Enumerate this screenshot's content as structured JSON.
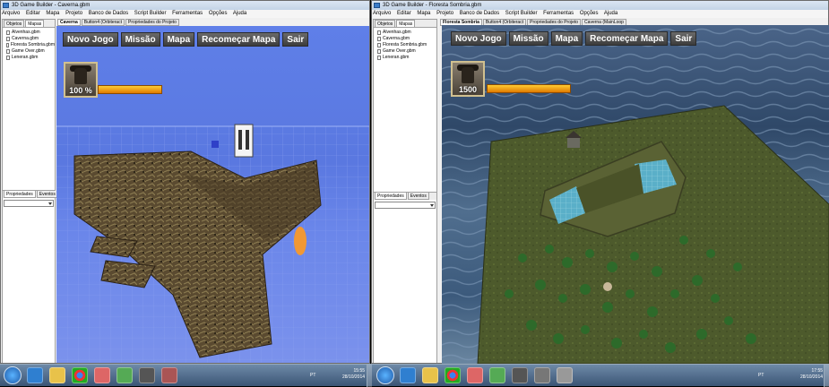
{
  "left_window": {
    "title": "3D Game Builder - Caverna.gbm",
    "menu": [
      "Arquivo",
      "Editar",
      "Mapa",
      "Projeto",
      "Banco de Dados",
      "Script Builder",
      "Ferramentas",
      "Opções",
      "Ajuda"
    ],
    "panel_tabs": [
      "Objetos",
      "Mapas"
    ],
    "tree_items": [
      "Alvenhas.gbm",
      "Caverna.gbm",
      "Floresta Sombria.gbm",
      "Game Over.gbm",
      "Leneran.gbm"
    ],
    "prop_tabs": [
      "Propriedades",
      "Eventos"
    ],
    "doc_tabs": [
      "Caverna",
      "Button4 (Orbiteract",
      "Propriedades do Projeto"
    ],
    "hud_buttons": [
      "Novo Jogo",
      "Missão",
      "Mapa",
      "Recomeçar Mapa",
      "Sair"
    ],
    "portrait_value": "100 %",
    "health_fraction": 1.0
  },
  "right_window": {
    "title": "3D Game Builder - Floresta Sombria.gbm",
    "menu": [
      "Arquivo",
      "Editar",
      "Mapa",
      "Projeto",
      "Banco de Dados",
      "Script Builder",
      "Ferramentas",
      "Opções",
      "Ajuda"
    ],
    "panel_tabs": [
      "Objetos",
      "Mapas"
    ],
    "tree_items": [
      "Alvenhas.gbm",
      "Caverna.gbm",
      "Floresta Sombria.gbm",
      "Game Over.gbm",
      "Leneran.gbm"
    ],
    "prop_tabs": [
      "Propriedades",
      "Eventos"
    ],
    "doc_tabs": [
      "Floresta Sombria",
      "Button4 (Orbiteract",
      "Propriedades do Projeto",
      "Caverna (MainLoop"
    ],
    "hud_buttons": [
      "Novo Jogo",
      "Missão",
      "Mapa",
      "Recomeçar Mapa",
      "Sair"
    ],
    "portrait_value": "1500",
    "health_fraction": 1.0
  },
  "taskbar": {
    "left_clock": {
      "time": "15:55",
      "date": "28/10/2014"
    },
    "left_lang": "PT",
    "right_clock": {
      "time": "17:55",
      "date": "28/10/2014"
    },
    "right_lang": "PT",
    "pinned_icons": [
      "start-orb",
      "ie-icon",
      "explorer-icon",
      "chrome-icon",
      "java-icon",
      "app-icon",
      "app-icon",
      "app-icon"
    ]
  },
  "colors": {
    "left_sky": "#5f7fe8",
    "hud_button_bg": "#4a4a4a",
    "health_bar": "#ffaa00",
    "grass": "#4d5a2c",
    "water": "#5ab8d8"
  }
}
